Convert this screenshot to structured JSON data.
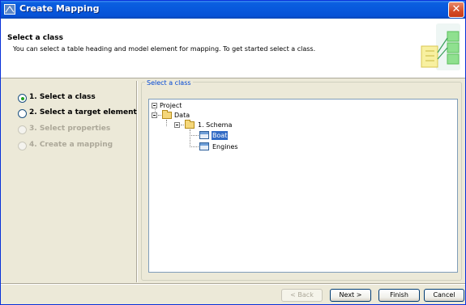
{
  "window": {
    "title": "Create Mapping",
    "close_glyph": "✕"
  },
  "header": {
    "title": "Select a class",
    "description": "You can select a table heading and model element for mapping. To get started select a class."
  },
  "steps": [
    {
      "label": "1. Select a class",
      "selected": true,
      "enabled": true
    },
    {
      "label": "2. Select a target element",
      "selected": false,
      "enabled": true
    },
    {
      "label": "3. Select properties",
      "selected": false,
      "enabled": false
    },
    {
      "label": "4. Create a mapping",
      "selected": false,
      "enabled": false
    }
  ],
  "group": {
    "legend": "Select a class"
  },
  "tree": {
    "root": "Project",
    "data": "Data",
    "schema": "1. Schema",
    "boat": "Boat",
    "engines": "Engines",
    "selected": "Boat"
  },
  "buttons": {
    "back": "< Back",
    "next": "Next >",
    "finish": "Finish",
    "cancel": "Cancel"
  },
  "icons": {
    "title": "app-icon",
    "close": "close-icon",
    "folder": "folder-icon",
    "class": "class-icon",
    "header": "mapping-diagram-icon"
  },
  "colors": {
    "titlebar": "#0858dc",
    "accent": "#0046d5",
    "selection": "#316ac5"
  }
}
